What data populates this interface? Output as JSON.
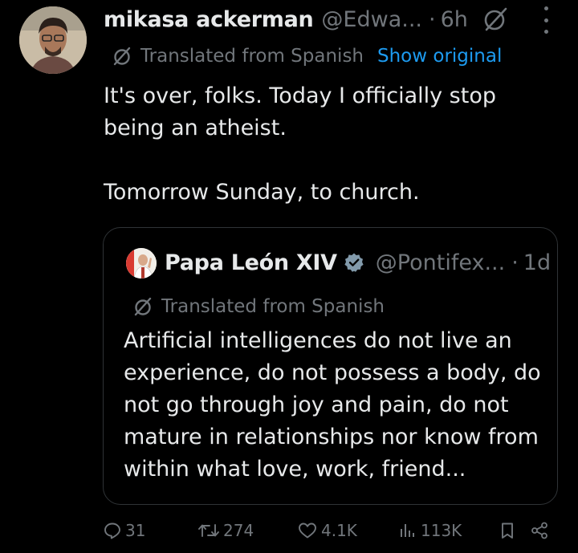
{
  "tweet": {
    "author": {
      "display_name": "mikasa ackerman",
      "handle": "@Edwa...",
      "time_sep": "·",
      "time": "6h"
    },
    "translated_label": "Translated from Spanish",
    "show_original_label": "Show original",
    "text": "It's over, folks. Today I officially stop\nbeing an atheist.\n\nTomorrow Sunday, to church.",
    "quoted": {
      "display_name": "Papa León XIV",
      "handle": "@Pontifex...",
      "time_sep": "·",
      "time": "1d",
      "translated_label": "Translated from Spanish",
      "text": "Artificial intelligences do not live an experience, do not possess a body, do not go through joy and pain, do not mature in relationships nor know from within what love, work, friend..."
    },
    "actions": {
      "replies": "31",
      "reposts": "274",
      "likes": "4.1K",
      "views": "113K"
    }
  },
  "colors": {
    "background": "#000000",
    "text": "#e7e9ea",
    "muted": "#71767b",
    "link": "#1d9bf0",
    "border": "#2f3336"
  },
  "icons": [
    "grok-icon",
    "more-icon",
    "translate-icon",
    "verified-badge-icon",
    "reply-icon",
    "repost-icon",
    "like-icon",
    "views-icon",
    "bookmark-icon",
    "share-icon"
  ]
}
